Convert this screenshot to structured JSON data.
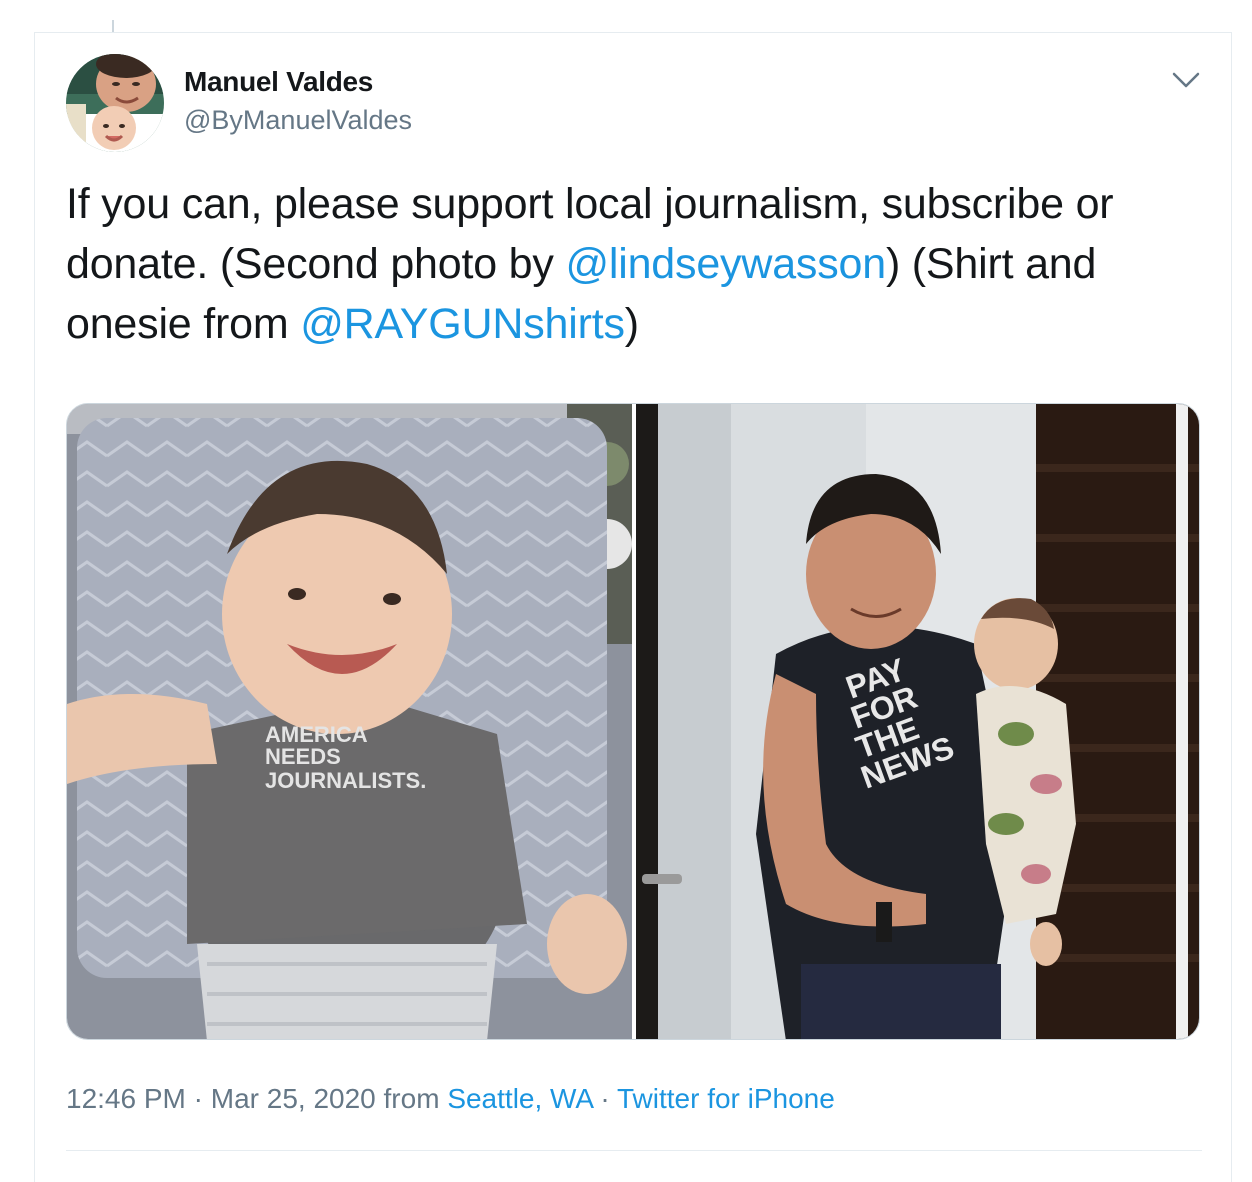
{
  "author": {
    "display_name": "Manuel Valdes",
    "handle": "@ByManuelValdes"
  },
  "tweet": {
    "text_parts": [
      "If you can, please support local journalism, subscribe or donate. (Second photo by ",
      "@lindseywasson",
      ") (Shirt and onesie from ",
      "@RAYGUNshirts",
      ")"
    ]
  },
  "media": {
    "photo1_shirt_text": [
      "AMERICA",
      "NEEDS",
      "JOURNALISTS."
    ],
    "photo2_shirt_text": [
      "PAY",
      "FOR",
      "THE",
      "NEWS"
    ]
  },
  "meta": {
    "time": "12:46 PM",
    "sep1": " · ",
    "date": "Mar 25, 2020",
    "from_label": " from ",
    "location": "Seattle, WA",
    "sep2": " · ",
    "source": "Twitter for iPhone"
  },
  "colors": {
    "link": "#1b95e0",
    "secondary_text": "#657786",
    "border": "#e6ecf0"
  },
  "icons": {
    "caret": "chevron-down-icon"
  }
}
